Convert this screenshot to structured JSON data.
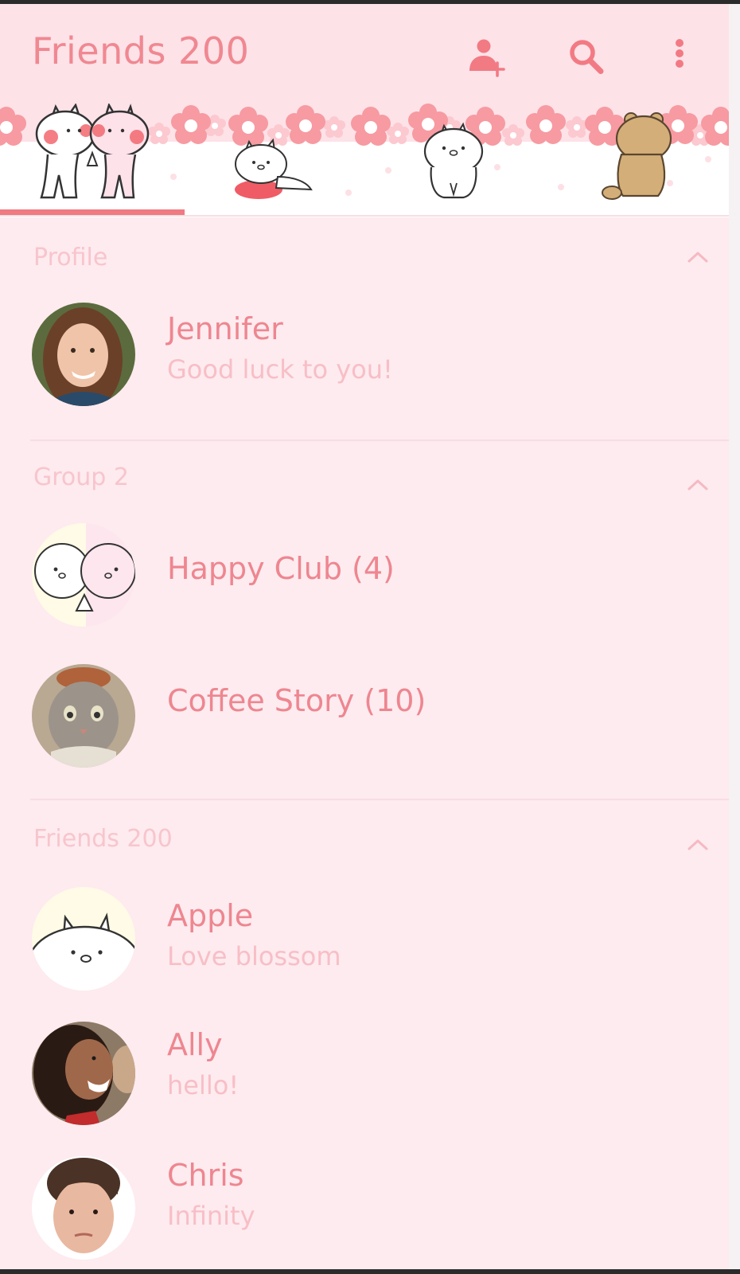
{
  "header": {
    "title": "Friends 200",
    "icons": [
      "add-friend-icon",
      "search-icon",
      "more-vertical-icon"
    ]
  },
  "tabs": [
    {
      "icon": "bunny-pair-sticker",
      "selected": true
    },
    {
      "icon": "bunny-lying-sticker",
      "selected": false
    },
    {
      "icon": "bunny-sitting-sticker",
      "selected": false
    },
    {
      "icon": "bear-sticker",
      "selected": false
    }
  ],
  "sections": {
    "profile": {
      "label": "Profile"
    },
    "groups": {
      "label": "Group 2"
    },
    "friends": {
      "label": "Friends 200"
    }
  },
  "profile": {
    "name": "Jennifer",
    "status": "Good luck to you!"
  },
  "groups": [
    {
      "name": "Happy Club (4)"
    },
    {
      "name": "Coffee Story (10)"
    }
  ],
  "friends": [
    {
      "name": "Apple",
      "status": "Love blossom"
    },
    {
      "name": "Ally",
      "status": "hello!"
    },
    {
      "name": "Chris",
      "status": "Infinity"
    }
  ],
  "colors": {
    "background": "#fdebef",
    "header": "#fde2e8",
    "accent": "#f07a82",
    "name_text": "#ee8690",
    "secondary_text": "#f8bec6"
  }
}
